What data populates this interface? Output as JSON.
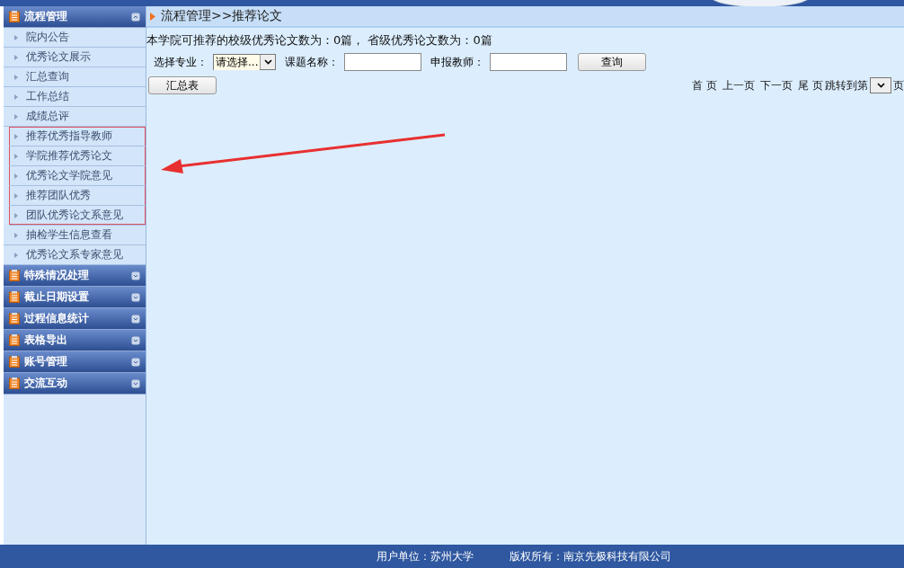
{
  "sidebar": {
    "sections": [
      {
        "title": "流程管理",
        "expanded": true,
        "items": [
          {
            "label": "院内公告",
            "highlighted": false
          },
          {
            "label": "优秀论文展示",
            "highlighted": false
          },
          {
            "label": "汇总查询",
            "highlighted": false
          },
          {
            "label": "工作总结",
            "highlighted": false
          },
          {
            "label": "成绩总评",
            "highlighted": false
          },
          {
            "label": "推荐优秀指导教师",
            "highlighted": true
          },
          {
            "label": "学院推荐优秀论文",
            "highlighted": true
          },
          {
            "label": "优秀论文学院意见",
            "highlighted": true
          },
          {
            "label": "推荐团队优秀",
            "highlighted": true
          },
          {
            "label": "团队优秀论文系意见",
            "highlighted": true
          },
          {
            "label": "抽检学生信息查看",
            "highlighted": false
          },
          {
            "label": "优秀论文系专家意见",
            "highlighted": false
          }
        ]
      },
      {
        "title": "特殊情况处理",
        "expanded": false
      },
      {
        "title": "截止日期设置",
        "expanded": false
      },
      {
        "title": "过程信息统计",
        "expanded": false
      },
      {
        "title": "表格导出",
        "expanded": false
      },
      {
        "title": "账号管理",
        "expanded": false
      },
      {
        "title": "交流互动",
        "expanded": false
      }
    ]
  },
  "breadcrumb": "流程管理>>推荐论文",
  "summary": "本学院可推荐的校级优秀论文数为：0篇，  省级优秀论文数为：0篇",
  "filters": [
    {
      "kind": "select",
      "label": "选择专业：",
      "value": "请选择..."
    },
    {
      "kind": "input",
      "label": "课题名称："
    },
    {
      "kind": "input",
      "label": "申报教师："
    }
  ],
  "query_button": "查询",
  "summary_button": "汇总表",
  "pager": {
    "first": "首 页",
    "prev": "上一页",
    "next": "下一页",
    "last": "尾 页",
    "jump_label": "跳转到第",
    "page_unit": "页"
  },
  "footer": {
    "unit": "用户单位：苏州大学",
    "copyright": "版权所有：南京先极科技有限公司"
  }
}
